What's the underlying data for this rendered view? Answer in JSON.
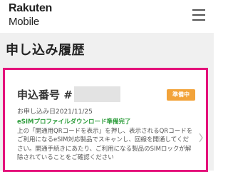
{
  "header": {
    "logo_line1": "Rakuten",
    "logo_line2": "Mobile",
    "menu_icon": "hamburger-icon"
  },
  "page": {
    "title": "申し込み履歴"
  },
  "application": {
    "number_label": "申込番号 #",
    "number_value_redacted": true,
    "status": "準備中",
    "apply_date": "お申し込み日2021/11/25",
    "download_status": "eSIMプロファイルダウンロード準備完了",
    "description": "上の「開通用QRコードを表示」を押し、表示されるQRコードをご利用になるeSIM対応製品でスキャンし、回線を開通してください。開通手続きにあたり、ご利用になる製品のSIMロックが解除されていることをご確認ください",
    "chevron_icon": "chevron-right-icon"
  },
  "colors": {
    "highlight_border": "#e4127b",
    "status_badge": "#f2a33a",
    "download_status_text": "#2d9d3b",
    "section_background": "#f0f0f0"
  }
}
